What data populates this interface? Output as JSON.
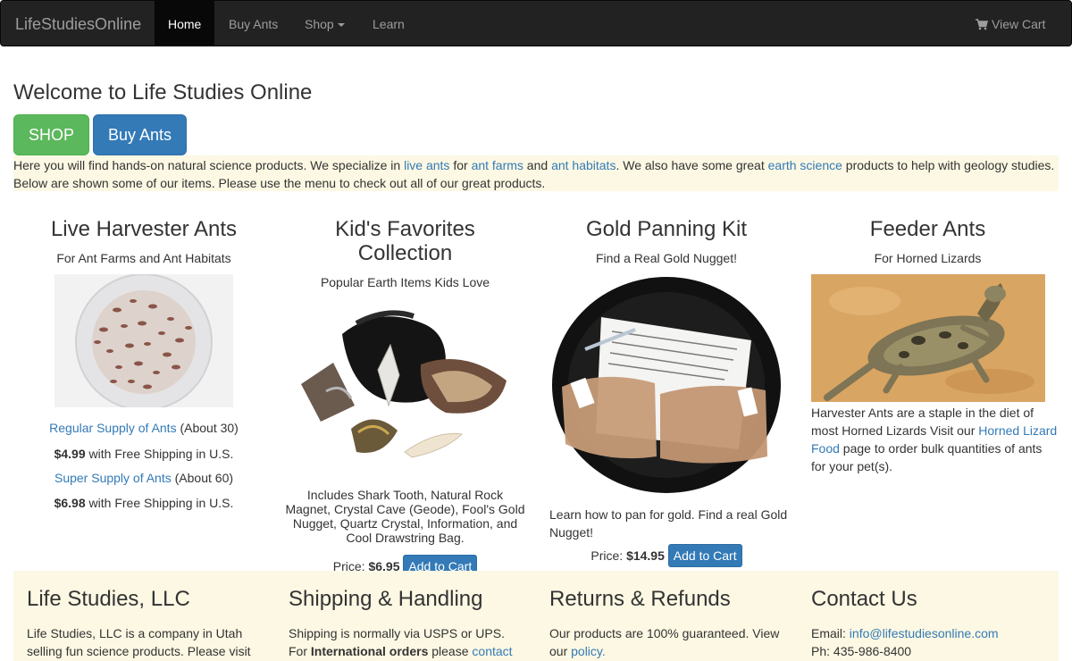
{
  "nav": {
    "brand": "LifeStudiesOnline",
    "home": "Home",
    "buy_ants": "Buy Ants",
    "shop": "Shop",
    "learn": "Learn",
    "view_cart": "View Cart"
  },
  "hero": {
    "title": "Welcome to Life Studies Online",
    "shop_button": "SHOP",
    "buy_ants_button": "Buy Ants"
  },
  "intro": {
    "t1": "Here you will find hands-on natural science products. We specialize in ",
    "link_live_ants": "live ants",
    "t2": " for ",
    "link_ant_farms": "ant farms",
    "t3": " and ",
    "link_ant_habitats": "ant habitats",
    "t4": ". We also have some great ",
    "link_earth_science": "earth science",
    "t5": " products to help with geology studies.",
    "t6": "Below are shown some of our items. Please use the menu to check out all of our great products."
  },
  "products": {
    "ants": {
      "title": "Live Harvester Ants",
      "subtitle": "For Ant Farms and Ant Habitats",
      "regular_link": "Regular Supply of Ants",
      "regular_note": " (About 30)",
      "regular_price": "$4.99",
      "regular_ship": " with Free Shipping in U.S.",
      "super_link": "Super Supply of Ants",
      "super_note": " (About 60)",
      "super_price": "$6.98",
      "super_ship": " with Free Shipping in U.S."
    },
    "kids": {
      "title_line1": "Kid's Favorites",
      "title_line2": "Collection",
      "subtitle": "Popular Earth Items Kids Love",
      "description": "Includes Shark Tooth, Natural Rock Magnet, Crystal Cave (Geode), Fool's Gold Nugget, Quartz Crystal, Information, and Cool Drawstring Bag.",
      "price_label": "Price: ",
      "price": "$6.95",
      "button": "Add to Cart"
    },
    "gold": {
      "title": "Gold Panning Kit",
      "subtitle": "Find a Real Gold Nugget!",
      "description": "Learn how to pan for gold. Find a real Gold Nugget!",
      "price_label": "Price: ",
      "price": "$14.95",
      "button": "Add to Cart"
    },
    "feeder": {
      "title": "Feeder Ants",
      "subtitle": "For Horned Lizards",
      "t1": "Harvester Ants are a staple in the diet of most Horned Lizards Visit our ",
      "link": "Horned Lizard Food",
      "t2": " page to order bulk quantities of ants for your pet(s)."
    }
  },
  "footer": {
    "company": {
      "title": "Life Studies, LLC",
      "text": "Life Studies, LLC is a company in Utah selling fun science products. Please visit"
    },
    "shipping": {
      "title": "Shipping & Handling",
      "t1": "Shipping is normally via USPS or UPS.",
      "t2": "For ",
      "bold": "International orders",
      "t3": " please ",
      "link": "contact"
    },
    "returns": {
      "title": "Returns & Refunds",
      "t1": "Our products are 100% guaranteed. View our ",
      "link": "policy."
    },
    "contact": {
      "title": "Contact Us",
      "email_label": "Email: ",
      "email": "info@lifestudiesonline.com",
      "phone": "Ph: 435-986-8400"
    }
  },
  "colors": {
    "navbar": "#222222",
    "success": "#5cb85c",
    "primary": "#337ab7",
    "highlight": "#fcf8e3"
  }
}
